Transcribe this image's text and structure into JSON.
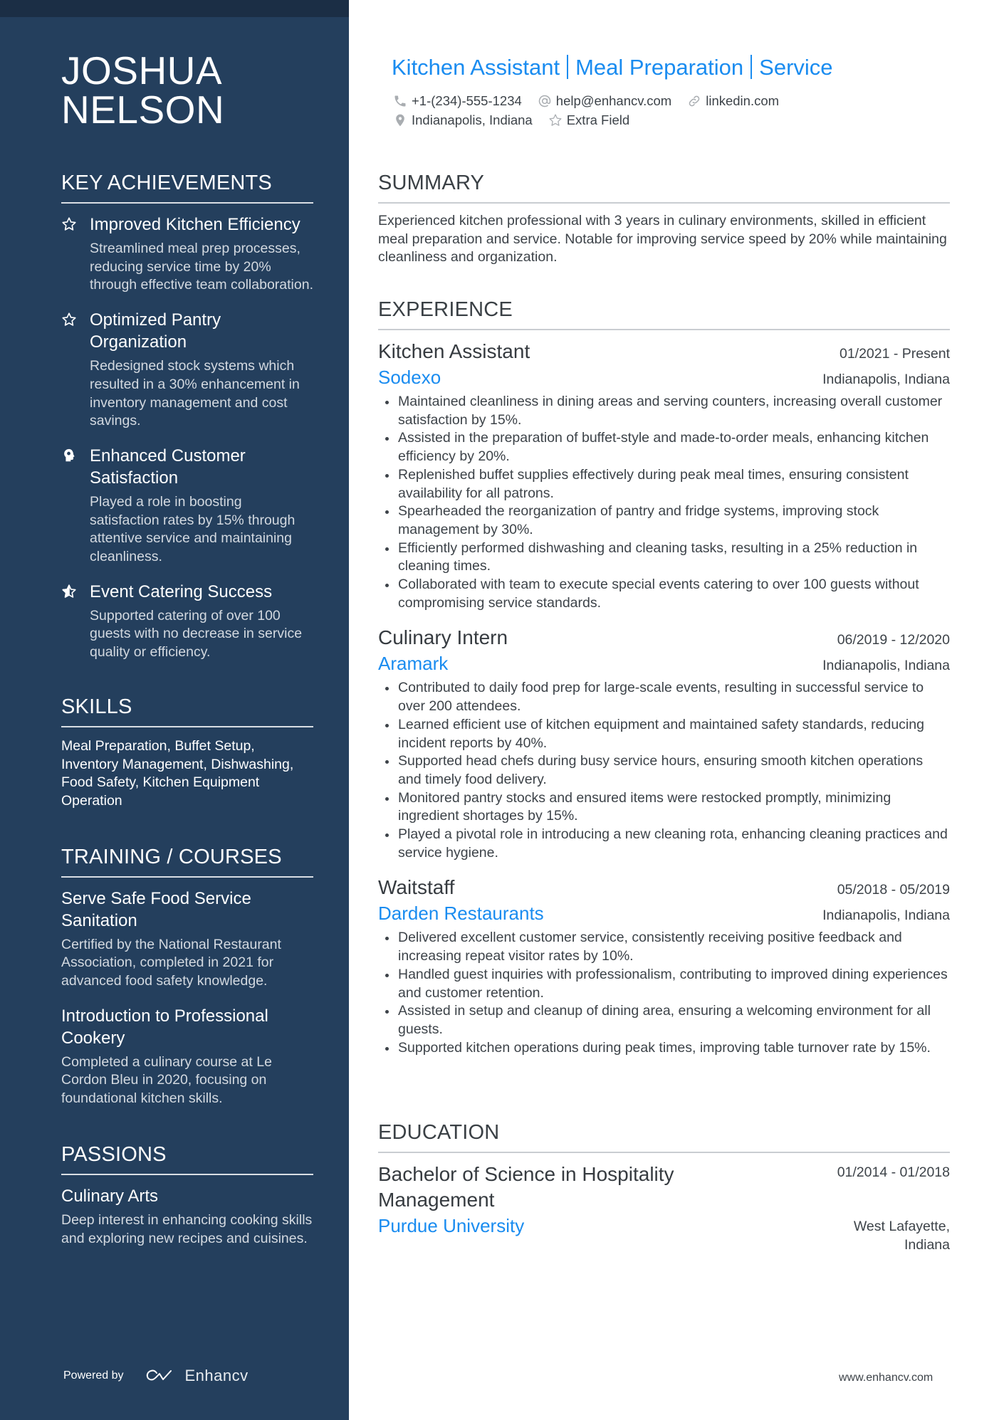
{
  "colors": {
    "sidebar_bg": "#243f5d",
    "sidebar_topband": "#1b2e45",
    "accent": "#1a8cf0",
    "text": "#3d4349"
  },
  "sidebar": {
    "name_line1": "JOSHUA",
    "name_line2": "NELSON",
    "key_achievements": {
      "title": "KEY ACHIEVEMENTS",
      "items": [
        {
          "icon": "star-outline-icon",
          "title": "Improved Kitchen Efficiency",
          "desc": "Streamlined meal prep processes, reducing service time by 20% through effective team collaboration."
        },
        {
          "icon": "star-outline-icon",
          "title": "Optimized Pantry Organization",
          "desc": "Redesigned stock systems which resulted in a 30% enhancement in inventory management and cost savings."
        },
        {
          "icon": "head-idea-icon",
          "title": "Enhanced Customer Satisfaction",
          "desc": "Played a role in boosting satisfaction rates by 15% through attentive service and maintaining cleanliness."
        },
        {
          "icon": "star-half-icon",
          "title": "Event Catering Success",
          "desc": "Supported catering of over 100 guests with no decrease in service quality or efficiency."
        }
      ]
    },
    "skills": {
      "title": "SKILLS",
      "text": "Meal Preparation, Buffet Setup, Inventory Management, Dishwashing, Food Safety, Kitchen Equipment Operation"
    },
    "training": {
      "title": "TRAINING / COURSES",
      "items": [
        {
          "title": "Serve Safe Food Service Sanitation",
          "desc": "Certified by the National Restaurant Association, completed in 2021 for advanced food safety knowledge."
        },
        {
          "title": "Introduction to Professional Cookery",
          "desc": "Completed a culinary course at Le Cordon Bleu in 2020, focusing on foundational kitchen skills."
        }
      ]
    },
    "passions": {
      "title": "PASSIONS",
      "items": [
        {
          "title": "Culinary Arts",
          "desc": "Deep interest in enhancing cooking skills and exploring new recipes and cuisines."
        }
      ]
    },
    "powered_by": "Powered by",
    "brand": "Enhancv"
  },
  "header": {
    "headline_parts": [
      "Kitchen Assistant",
      "Meal Preparation",
      "Service"
    ],
    "phone": "+1-(234)-555-1234",
    "email": "help@enhancv.com",
    "linkedin": "linkedin.com",
    "location": "Indianapolis, Indiana",
    "extra": "Extra Field"
  },
  "summary": {
    "title": "SUMMARY",
    "text": "Experienced kitchen professional with 3 years in culinary environments, skilled in efficient meal preparation and service. Notable for improving service speed by 20% while maintaining cleanliness and organization."
  },
  "experience": {
    "title": "EXPERIENCE",
    "jobs": [
      {
        "title": "Kitchen Assistant",
        "date": "01/2021 - Present",
        "company": "Sodexo",
        "location": "Indianapolis, Indiana",
        "bullets": [
          "Maintained cleanliness in dining areas and serving counters, increasing overall customer satisfaction by 15%.",
          "Assisted in the preparation of buffet-style and made-to-order meals, enhancing kitchen efficiency by 20%.",
          "Replenished buffet supplies effectively during peak meal times, ensuring consistent availability for all patrons.",
          "Spearheaded the reorganization of pantry and fridge systems, improving stock management by 30%.",
          "Efficiently performed dishwashing and cleaning tasks, resulting in a 25% reduction in cleaning times.",
          "Collaborated with team to execute special events catering to over 100 guests without compromising service standards."
        ]
      },
      {
        "title": "Culinary Intern",
        "date": "06/2019 - 12/2020",
        "company": "Aramark",
        "location": "Indianapolis, Indiana",
        "bullets": [
          "Contributed to daily food prep for large-scale events, resulting in successful service to over 200 attendees.",
          "Learned efficient use of kitchen equipment and maintained safety standards, reducing incident reports by 40%.",
          "Supported head chefs during busy service hours, ensuring smooth kitchen operations and timely food delivery.",
          "Monitored pantry stocks and ensured items were restocked promptly, minimizing ingredient shortages by 15%.",
          "Played a pivotal role in introducing a new cleaning rota, enhancing cleaning practices and service hygiene."
        ]
      },
      {
        "title": "Waitstaff",
        "date": "05/2018 - 05/2019",
        "company": "Darden Restaurants",
        "location": "Indianapolis, Indiana",
        "bullets": [
          "Delivered excellent customer service, consistently receiving positive feedback and increasing repeat visitor rates by 10%.",
          "Handled guest inquiries with professionalism, contributing to improved dining experiences and customer retention.",
          "Assisted in setup and cleanup of dining area, ensuring a welcoming environment for all guests.",
          "Supported kitchen operations during peak times, improving table turnover rate by 15%."
        ]
      }
    ]
  },
  "education": {
    "title": "EDUCATION",
    "items": [
      {
        "degree": "Bachelor of Science in Hospitality Management",
        "date": "01/2014 - 01/2018",
        "school": "Purdue University",
        "location": "West Lafayette, Indiana"
      }
    ]
  },
  "footer": {
    "url": "www.enhancv.com"
  }
}
